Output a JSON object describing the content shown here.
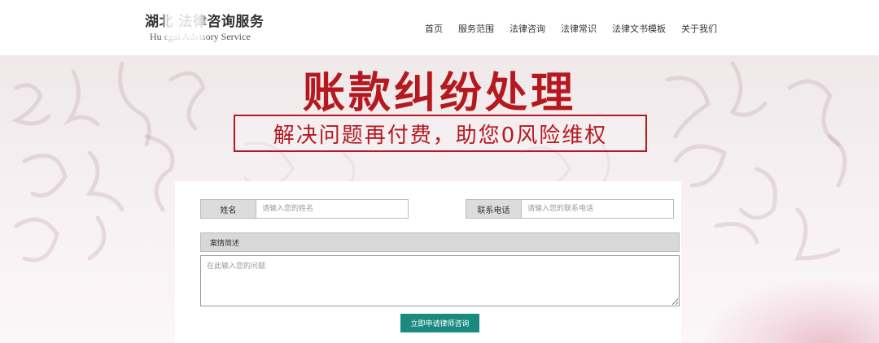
{
  "brand": {
    "title": "湖北  法律咨询服务",
    "subtitle": "Hu    egal Advisory Service"
  },
  "nav": {
    "items": [
      "首页",
      "服务范围",
      "法律咨询",
      "法律常识",
      "法律文书模板",
      "关于我们"
    ]
  },
  "banner": {
    "headline": "账款纠纷处理",
    "tagline": "解决问题再付费，助您0风险维权"
  },
  "form": {
    "name_label": "姓名",
    "name_placeholder": "请输入您的姓名",
    "phone_label": "联系电话",
    "phone_placeholder": "请输入您的联系电话",
    "description_label": "案情简述",
    "description_placeholder": "在此输入您的问题",
    "submit_label": "立即申请律师咨询"
  },
  "colors": {
    "accent_red": "#b5191f",
    "button_teal": "#1a8a7e"
  }
}
